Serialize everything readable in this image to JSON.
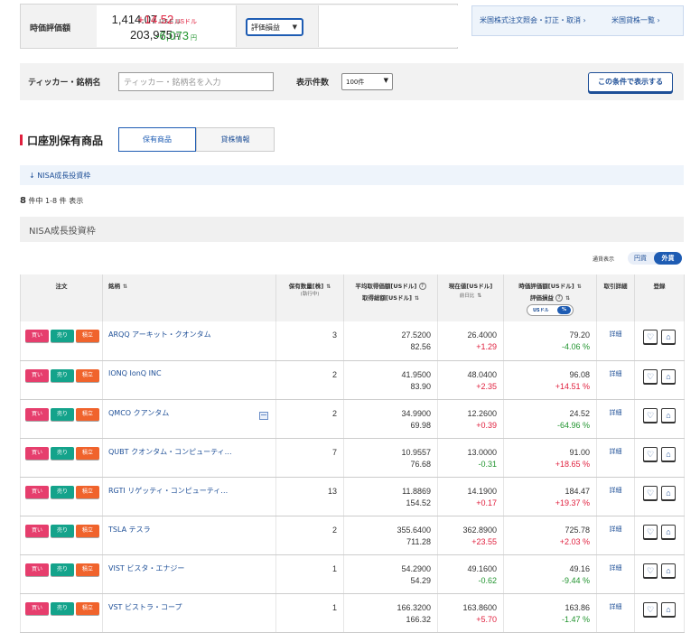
{
  "summary": {
    "label": "時価評価額",
    "value_usd": "1,414.07",
    "unit_usd": "USドル",
    "value_jpy": "203,975",
    "unit_jpy": "円",
    "select_value": "評価損益",
    "pl_usd": "+14.52",
    "pl_jpy": "-6,073"
  },
  "links": {
    "order_inquiry": "米国株式注文照会・訂正・取消",
    "lending_list": "米国貸株一覧"
  },
  "filter": {
    "ticker_label": "ティッカー・銘柄名",
    "ticker_placeholder": "ティッカー・銘柄名を入力",
    "display_count_label": "表示件数",
    "display_count_value": "100件",
    "submit_label": "この条件で表示する"
  },
  "section": {
    "title": "口座別保有商品",
    "tabs": [
      "保有商品",
      "貸株情報"
    ],
    "anchor": "NISA成長投資枠",
    "count_num": "8",
    "count_text": "件中 1-8 件 表示",
    "account_header": "NISA成長投資枠",
    "display_label": "通貨表示",
    "toggle_yen": "円貨",
    "toggle_usd": "外貨"
  },
  "table": {
    "headers": {
      "order": "注文",
      "name": "銘柄",
      "qty": "保有数量[株]",
      "qty_sub": "(執行中)",
      "avg": "平均取得価額[USドル]",
      "total": "取得総額[USドル]",
      "price": "現在値[USドル]",
      "price_sub": "前日比",
      "val": "時価評価額[USドル]",
      "pl": "評価損益",
      "pct_toggle_usd": "USドル",
      "pct_toggle_pct": "%",
      "detail": "取引詳細",
      "register": "登録"
    },
    "buttons": {
      "buy": "買い",
      "sell": "売り",
      "accum": "積立",
      "detail": "詳細"
    },
    "rows": [
      {
        "name": "ARQQ アーキット・クオンタム",
        "qty": "3",
        "avg": "27.5200",
        "total": "82.56",
        "price": "26.4000",
        "change": "+1.29",
        "val": "79.20",
        "pl": "-4.06 %"
      },
      {
        "name": "IONQ IonQ INC",
        "qty": "2",
        "avg": "41.9500",
        "total": "83.90",
        "price": "48.0400",
        "change": "+2.35",
        "val": "96.08",
        "pl": "+14.51 %"
      },
      {
        "name": "QMCO クアンタム",
        "qty": "2",
        "avg": "34.9900",
        "total": "69.98",
        "price": "12.2600",
        "change": "+0.39",
        "val": "24.52",
        "pl": "-64.96 %"
      },
      {
        "name": "QUBT クオンタム・コンピューティ…",
        "qty": "7",
        "avg": "10.9557",
        "total": "76.68",
        "price": "13.0000",
        "change": "-0.31",
        "val": "91.00",
        "pl": "+18.65 %"
      },
      {
        "name": "RGTI リゲッティ・コンピューティ…",
        "qty": "13",
        "avg": "11.8869",
        "total": "154.52",
        "price": "14.1900",
        "change": "+0.17",
        "val": "184.47",
        "pl": "+19.37 %"
      },
      {
        "name": "TSLA テスラ",
        "qty": "2",
        "avg": "355.6400",
        "total": "711.28",
        "price": "362.8900",
        "change": "+23.55",
        "val": "725.78",
        "pl": "+2.03 %"
      },
      {
        "name": "VIST ビスタ・エナジー",
        "qty": "1",
        "avg": "54.2900",
        "total": "54.29",
        "price": "49.1600",
        "change": "-0.62",
        "val": "49.16",
        "pl": "-9.44 %"
      },
      {
        "name": "VST ビストラ・コープ",
        "qty": "1",
        "avg": "166.3200",
        "total": "166.32",
        "price": "163.8600",
        "change": "+5.70",
        "val": "163.86",
        "pl": "-1.47 %"
      }
    ]
  },
  "colors": {
    "positive": "#e0203e",
    "negative": "#21942f",
    "accent": "#1e5cb3"
  }
}
